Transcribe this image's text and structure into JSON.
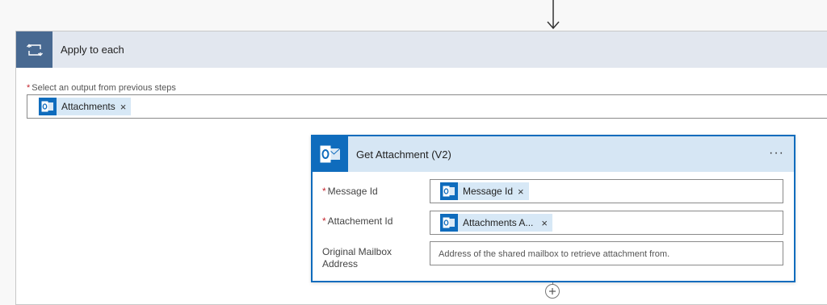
{
  "loop": {
    "title": "Apply to each",
    "output_label": "Select an output from previous steps",
    "required_mark": "*",
    "token": {
      "label": "Attachments",
      "remove": "×"
    }
  },
  "action": {
    "title": "Get Attachment (V2)",
    "menu": "···",
    "params": [
      {
        "label": "Message Id",
        "required": true,
        "token": "Message Id",
        "remove": "×"
      },
      {
        "label": "Attachement Id",
        "required": true,
        "token": "Attachments A...",
        "remove": "×"
      },
      {
        "label_line1": "Original Mailbox",
        "label_line2": "Address",
        "required": false,
        "placeholder": "Address of the shared mailbox to retrieve attachment from."
      }
    ]
  },
  "icons": {
    "loop": "loop-icon",
    "outlook": "outlook-icon",
    "arrow": "arrow-down-icon",
    "add": "plus-icon"
  },
  "colors": {
    "outlook_blue": "#0f6cbd",
    "loop_blue": "#486991",
    "required_red": "#c4262e",
    "token_bg": "#d7e8f6"
  }
}
